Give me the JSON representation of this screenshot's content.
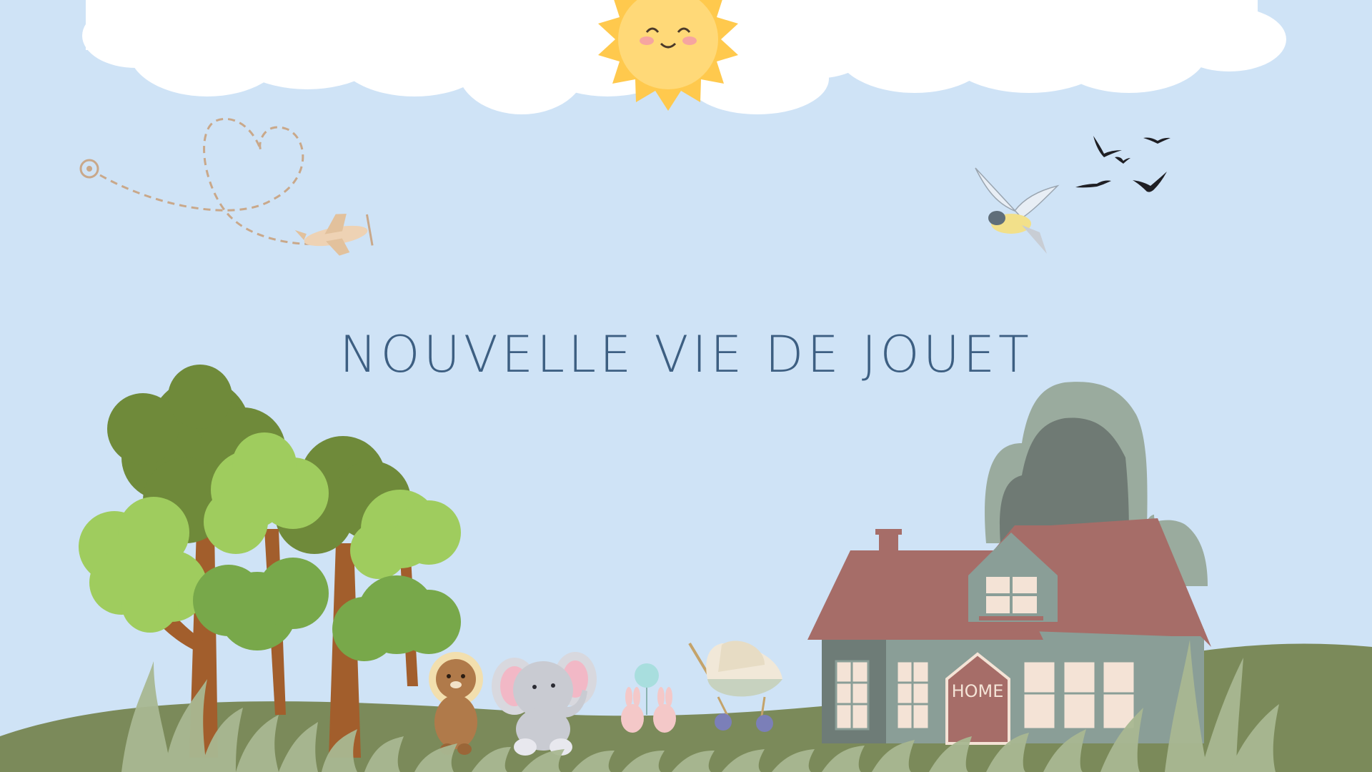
{
  "slide": {
    "title": "NOUVELLE VIE DE JOUET",
    "house_sign": "HOME"
  },
  "colors": {
    "sky": "#cfe3f6",
    "title": "#3d5f82",
    "ground": "#7b8a5a",
    "roof": "#a66d68",
    "house_wall": "#8a9e97",
    "sun": "#ffd666",
    "tree_dark": "#6f8a3a",
    "tree_light": "#9fcc5e"
  },
  "illustrations": [
    "cloud-icon",
    "sun-icon",
    "paper-plane-icon",
    "bird-icon",
    "tree-icon",
    "house-icon",
    "lion-toy-icon",
    "elephant-toy-icon",
    "bunny-toy-icon",
    "stroller-icon",
    "grass-icon"
  ]
}
